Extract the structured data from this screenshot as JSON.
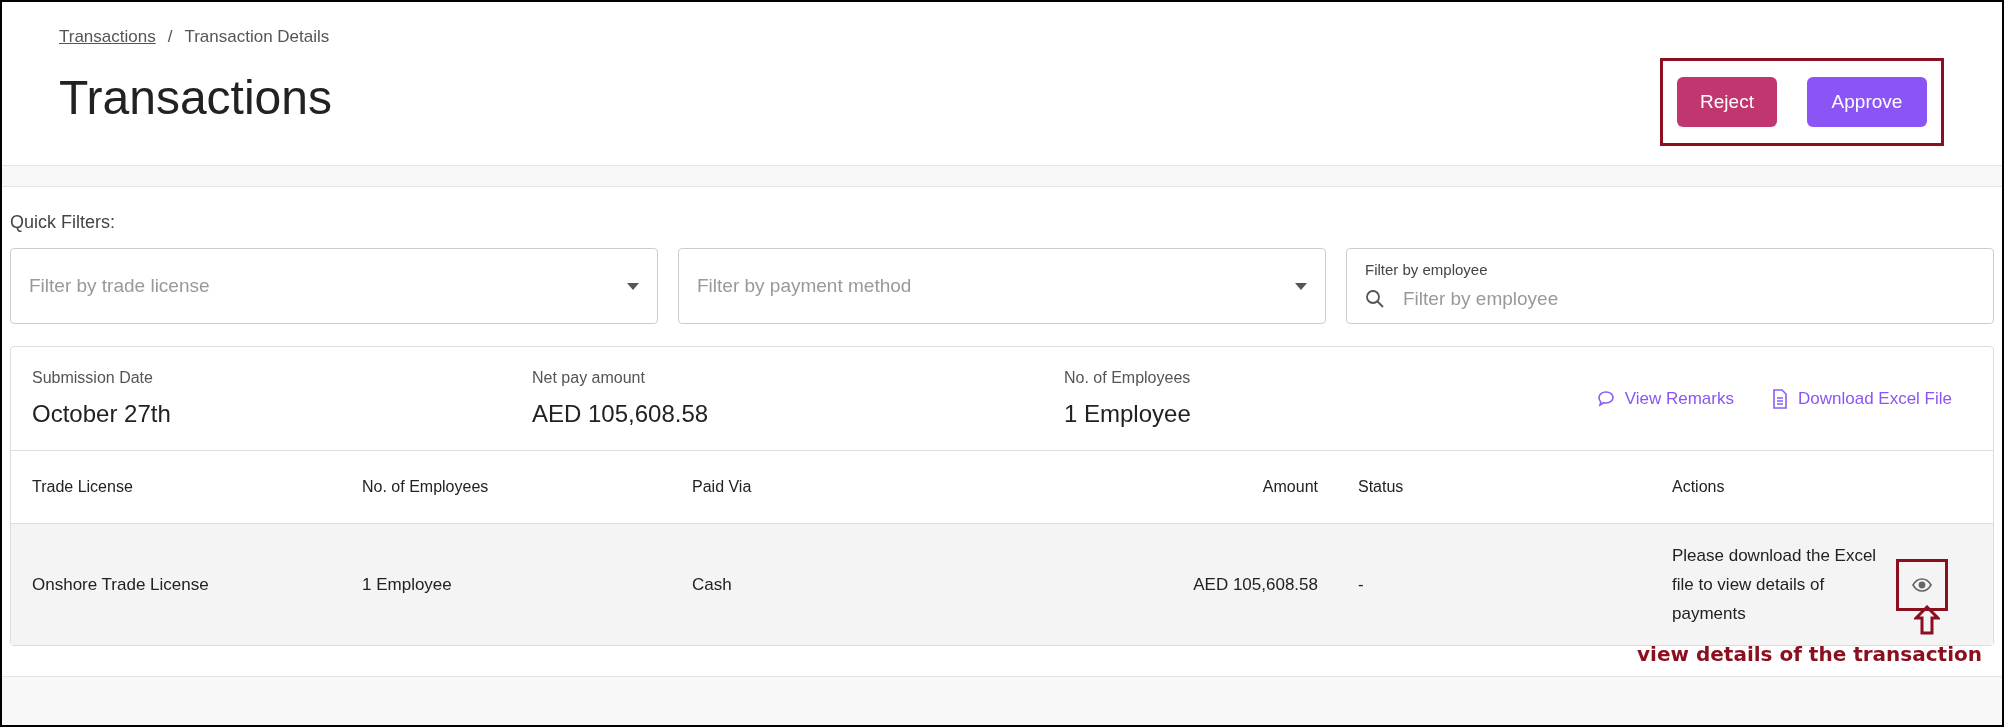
{
  "breadcrumb": [
    {
      "label": "Transactions",
      "kind": "link"
    },
    {
      "label": "Transaction Details",
      "kind": "current"
    }
  ],
  "breadcrumb_separator": "/",
  "page_title": "Transactions",
  "actions": [
    {
      "label": "Reject",
      "kind": "reject"
    },
    {
      "label": "Approve",
      "kind": "approve"
    }
  ],
  "quick_filters": {
    "label": "Quick Filters:",
    "filters": [
      {
        "kind": "select",
        "placeholder": "Filter by trade license"
      },
      {
        "kind": "select",
        "placeholder": "Filter by payment method"
      },
      {
        "kind": "search",
        "label": "Filter by employee",
        "placeholder": "Filter by employee"
      }
    ]
  },
  "summary": {
    "items": [
      {
        "label": "Submission Date",
        "value": "October 27th"
      },
      {
        "label": "Net pay amount",
        "value": "AED 105,608.58"
      },
      {
        "label": "No. of Employees",
        "value": "1 Employee"
      }
    ],
    "links": [
      {
        "label": "View Remarks",
        "kind": "remarks"
      },
      {
        "label": "Download Excel File",
        "kind": "download"
      }
    ]
  },
  "table": {
    "columns": [
      "Trade License",
      "No. of Employees",
      "Paid Via",
      "Amount",
      "Status",
      "Actions"
    ],
    "rows": [
      {
        "trade_license": "Onshore Trade License",
        "employees": "1 Employee",
        "paid_via": "Cash",
        "amount": "AED 105,608.58",
        "status": "-",
        "actions_note": "Please download the Excel file to view details of payments"
      }
    ]
  },
  "annotation": {
    "text": "view details of the transaction"
  }
}
